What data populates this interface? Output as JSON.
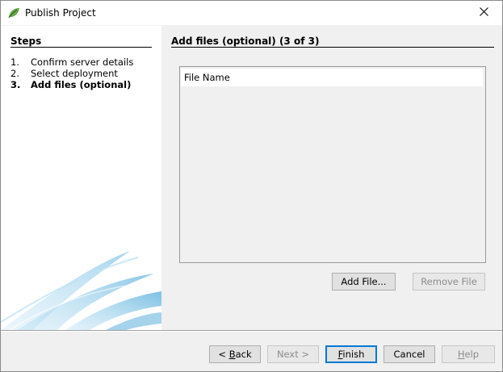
{
  "window": {
    "title": "Publish Project"
  },
  "steps": {
    "heading": "Steps",
    "items": [
      {
        "num": "1.",
        "label": "Confirm server details"
      },
      {
        "num": "2.",
        "label": "Select deployment"
      },
      {
        "num": "3.",
        "label": "Add files (optional)"
      }
    ],
    "current_index": 2
  },
  "content": {
    "heading": "Add files (optional) (3 of 3)",
    "table": {
      "columns": [
        "File Name"
      ],
      "rows": []
    },
    "add_file_label": "Add File...",
    "remove_file_label": "Remove File"
  },
  "footer": {
    "back": {
      "pre": "< ",
      "mnemonic": "B",
      "post": "ack"
    },
    "next": {
      "label": "Next >"
    },
    "finish": {
      "pre": "",
      "mnemonic": "F",
      "post": "inish"
    },
    "cancel": {
      "label": "Cancel"
    },
    "help": {
      "pre": "",
      "mnemonic": "H",
      "post": "elp"
    }
  },
  "icons": {
    "app": "leaf-icon",
    "close": "close-icon"
  },
  "colors": {
    "default_button_border": "#0078d7",
    "swoosh": "#4aa8d8"
  }
}
